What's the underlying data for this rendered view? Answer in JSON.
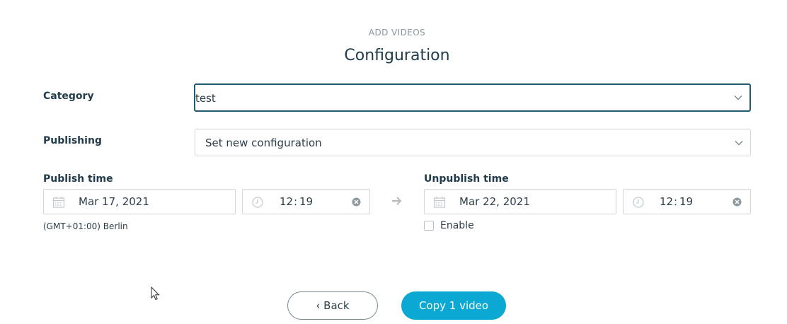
{
  "header": {
    "step_label": "ADD VIDEOS",
    "title": "Configuration"
  },
  "category": {
    "label": "Category",
    "value": "test",
    "icon": "chevron-down-icon"
  },
  "publishing": {
    "label": "Publishing",
    "value": "Set new configuration",
    "icon": "chevron-down-icon"
  },
  "publish": {
    "label": "Publish time",
    "date": "Mar 17, 2021",
    "time_hour": "12",
    "time_sep": ":",
    "time_min": "19",
    "timezone": "(GMT+01:00) Berlin"
  },
  "unpublish": {
    "label": "Unpublish time",
    "date": "Mar 22, 2021",
    "time_hour": "12",
    "time_sep": ":",
    "time_min": "19",
    "enable_label": "Enable",
    "enable_checked": false
  },
  "actions": {
    "back_label": "‹ Back",
    "copy_label": "Copy 1 video"
  },
  "colors": {
    "primary": "#0aa8d3",
    "text": "#1f3b4d",
    "focus_border": "#1f5a6e",
    "border": "#d3d7da"
  }
}
